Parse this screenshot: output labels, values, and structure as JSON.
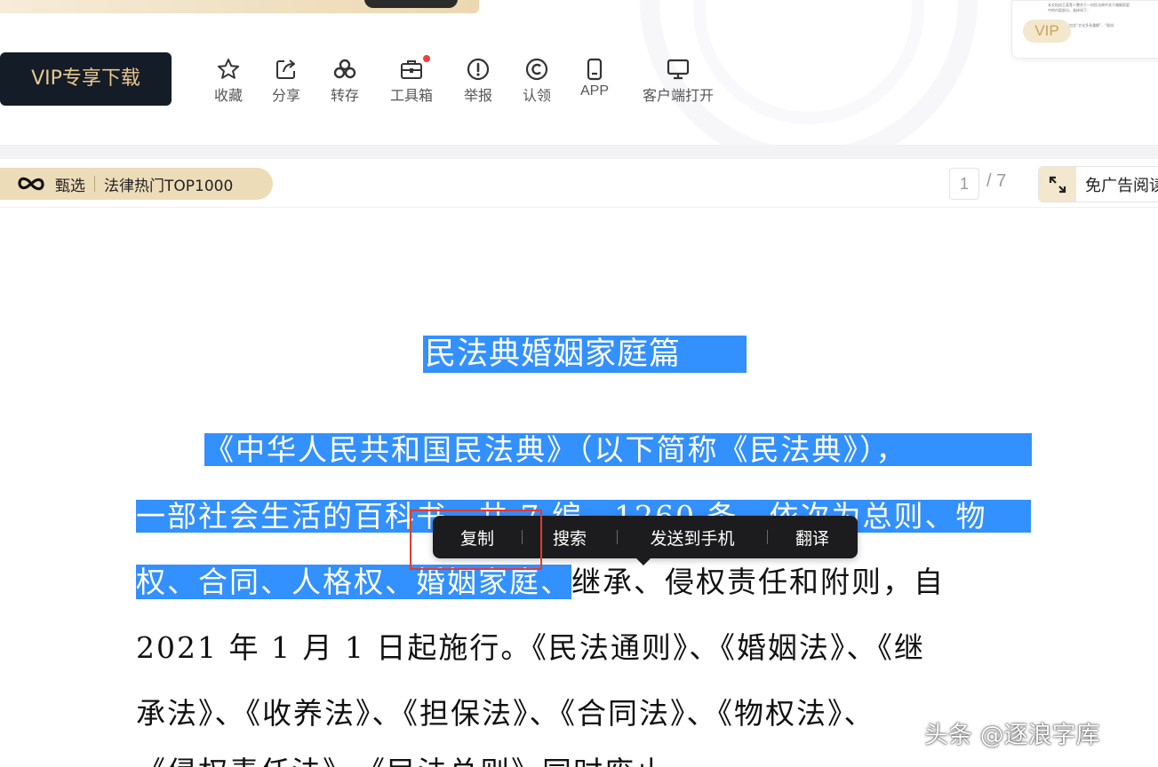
{
  "promo": {
    "vip_badge": "VIP",
    "tiny_lines": [
      "本文档由王某等人整合于一份民法典中关于婚姻家庭",
      "中的内容部分。具体如下：",
      "尊享深度资产包含“文化多多重解”、“股份"
    ]
  },
  "toolbar": {
    "vip_download_label": "VIP专享下载",
    "tools": [
      {
        "label": "收藏",
        "icon": "star-icon"
      },
      {
        "label": "分享",
        "icon": "share-icon"
      },
      {
        "label": "转存",
        "icon": "cloud-save-icon"
      },
      {
        "label": "工具箱",
        "icon": "toolbox-icon",
        "has_notification_dot": true
      },
      {
        "label": "举报",
        "icon": "report-icon"
      },
      {
        "label": "认领",
        "icon": "copyright-icon"
      },
      {
        "label": "APP",
        "icon": "phone-icon"
      },
      {
        "label": "客户端打开",
        "icon": "monitor-icon"
      }
    ]
  },
  "doc_bar": {
    "brand": "甄选",
    "category": "法律热门TOP1000",
    "current_page": "1",
    "total_pages": "/ 7",
    "no_ad_label": "免广告阅读"
  },
  "document": {
    "title": "民法典婚姻家庭篇",
    "line1": "《中华人民共和国民法典》（以下简称《民法典》），",
    "line2": "一部社会生活的百科书，共 7 编、1260 条，依次为总则、物",
    "line3_selected": "权、合同、人格权、婚姻家庭、",
    "line3_rest": "继承、侵权责任和附则，自",
    "line4": "2021 年 1 月 1 日起施行。《民法通则》、《婚姻法》、《继",
    "line5": "承法》、《收养法》、《担保法》、《合同法》、《物权法》、",
    "line6": "《侵权责任法》、《民法总则》同时废止。"
  },
  "context_menu": {
    "items": [
      "复制",
      "搜索",
      "发送到手机",
      "翻译"
    ]
  },
  "watermark": "头条 @逐浪字库",
  "colors": {
    "selection": "#3390ff",
    "vip_button_bg": "#141c27",
    "vip_button_text": "#e9c88f",
    "tag_pill": "#eddcb8",
    "context_menu_bg": "#1c1c1e",
    "highlight_box": "#e53935"
  }
}
